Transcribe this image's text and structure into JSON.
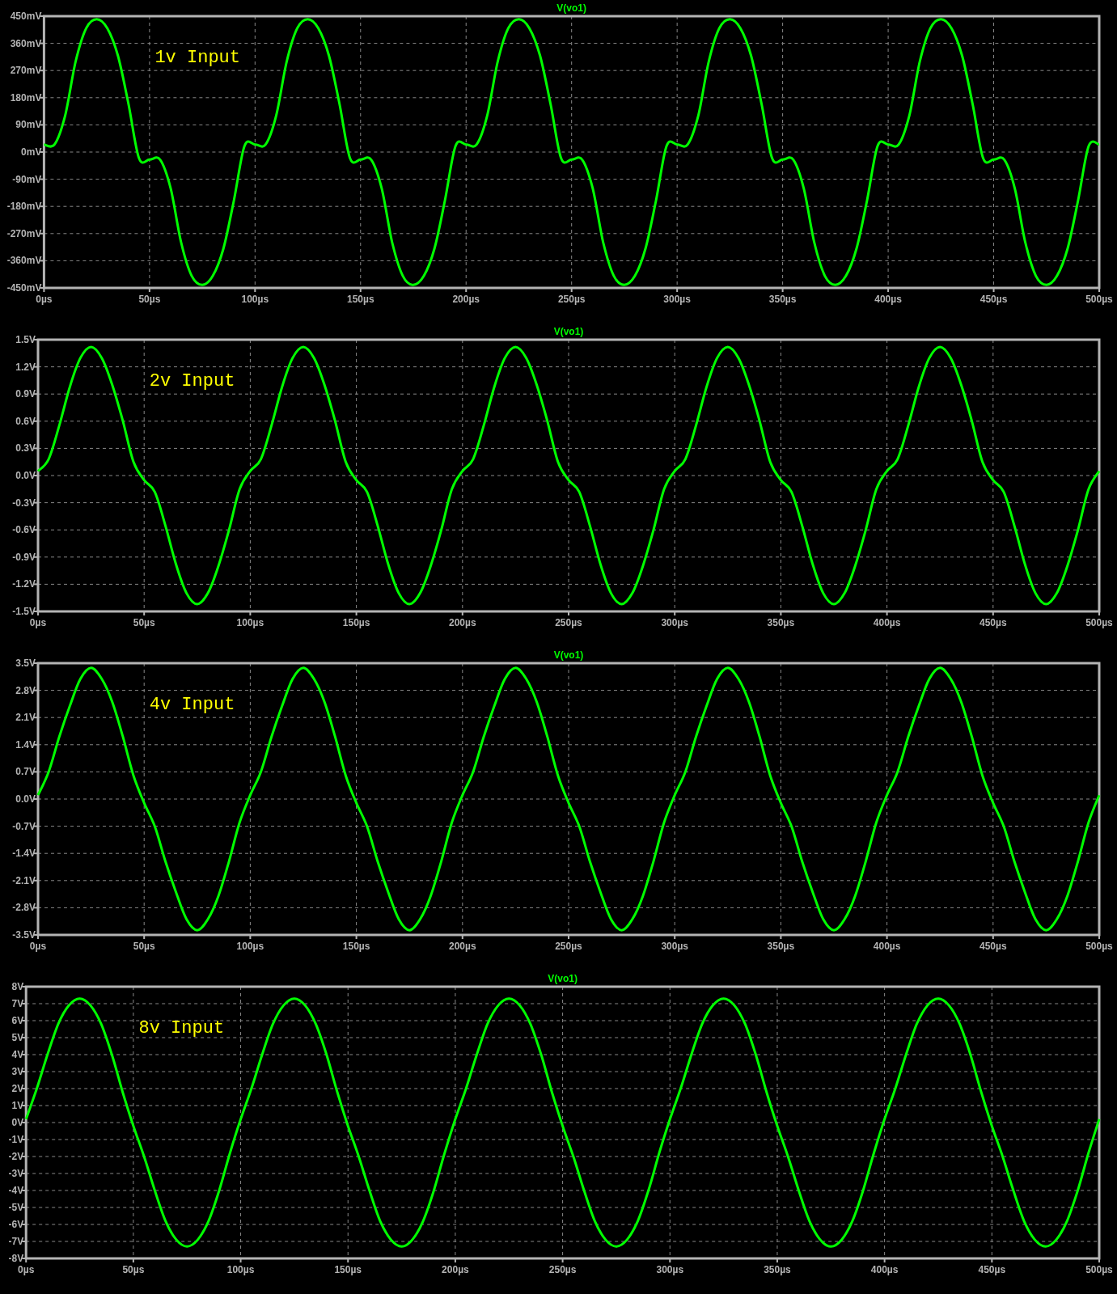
{
  "plots": [
    {
      "chart_data": {
        "type": "line",
        "x": [
          0,
          5,
          10,
          15,
          20,
          25,
          30,
          35,
          40,
          45,
          50,
          55,
          60,
          65,
          70,
          75,
          80,
          85,
          90,
          95,
          100,
          105,
          110,
          115,
          120,
          125,
          130,
          135,
          140,
          145,
          150,
          155,
          160,
          165,
          170,
          175,
          180,
          185,
          190,
          195,
          200,
          205,
          210,
          215,
          220,
          225,
          230,
          235,
          240,
          245,
          250,
          255,
          260,
          265,
          270,
          275,
          280,
          285,
          290,
          295,
          300,
          305,
          310,
          315,
          320,
          325,
          330,
          335,
          340,
          345,
          350,
          355,
          360,
          365,
          370,
          375,
          380,
          385,
          390,
          395,
          400,
          405,
          410,
          415,
          420,
          425,
          430,
          435,
          440,
          445,
          450,
          455,
          460,
          465,
          470,
          475,
          480,
          485,
          490,
          495,
          500
        ],
        "series": [
          {
            "name": "V(vo1)",
            "color": "#00ff00",
            "values": [
              25,
              25,
              120,
              300,
              410,
              440,
              410,
              320,
              160,
              -20,
              -25,
              -25,
              -120,
              -300,
              -410,
              -440,
              -410,
              -320,
              -160,
              20,
              25,
              25,
              120,
              300,
              410,
              440,
              410,
              320,
              160,
              -20,
              -25,
              -25,
              -120,
              -300,
              -410,
              -440,
              -410,
              -320,
              -160,
              20,
              25,
              25,
              120,
              300,
              410,
              440,
              410,
              320,
              160,
              -20,
              -25,
              -25,
              -120,
              -300,
              -410,
              -440,
              -410,
              -320,
              -160,
              20,
              25,
              25,
              120,
              300,
              410,
              440,
              410,
              320,
              160,
              -20,
              -25,
              -25,
              -120,
              -300,
              -410,
              -440,
              -410,
              -320,
              -160,
              20,
              25,
              25,
              120,
              300,
              410,
              440,
              410,
              320,
              160,
              -20,
              -25,
              -25,
              -120,
              -300,
              -410,
              -440,
              -410,
              -320,
              -160,
              20,
              25
            ]
          }
        ],
        "xlim": [
          0,
          500
        ],
        "ylim": [
          -450,
          450
        ],
        "grid": true,
        "xticks": [
          {
            "value": 0,
            "label": "0µs"
          },
          {
            "value": 50,
            "label": "50µs"
          },
          {
            "value": 100,
            "label": "100µs"
          },
          {
            "value": 150,
            "label": "150µs"
          },
          {
            "value": 200,
            "label": "200µs"
          },
          {
            "value": 250,
            "label": "250µs"
          },
          {
            "value": 300,
            "label": "300µs"
          },
          {
            "value": 350,
            "label": "350µs"
          },
          {
            "value": 400,
            "label": "400µs"
          },
          {
            "value": 450,
            "label": "450µs"
          },
          {
            "value": 500,
            "label": "500µs"
          }
        ],
        "yticks": [
          {
            "value": 450,
            "label": "450mV"
          },
          {
            "value": 360,
            "label": "360mV"
          },
          {
            "value": 270,
            "label": "270mV"
          },
          {
            "value": 180,
            "label": "180mV"
          },
          {
            "value": 90,
            "label": "90mV"
          },
          {
            "value": 0,
            "label": "0mV"
          },
          {
            "value": -90,
            "label": "-90mV"
          },
          {
            "value": -180,
            "label": "-180mV"
          },
          {
            "value": -270,
            "label": "-270mV"
          },
          {
            "value": -360,
            "label": "-360mV"
          },
          {
            "value": -450,
            "label": "-450mV"
          }
        ],
        "annotations": [
          "1v Input"
        ]
      }
    },
    {
      "chart_data": {
        "type": "line",
        "x": [
          0,
          5,
          10,
          15,
          20,
          25,
          30,
          35,
          40,
          45,
          50,
          55,
          60,
          65,
          70,
          75,
          80,
          85,
          90,
          95,
          100,
          105,
          110,
          115,
          120,
          125,
          130,
          135,
          140,
          145,
          150,
          155,
          160,
          165,
          170,
          175,
          180,
          185,
          190,
          195,
          200,
          205,
          210,
          215,
          220,
          225,
          230,
          235,
          240,
          245,
          250,
          255,
          260,
          265,
          270,
          275,
          280,
          285,
          290,
          295,
          300,
          305,
          310,
          315,
          320,
          325,
          330,
          335,
          340,
          345,
          350,
          355,
          360,
          365,
          370,
          375,
          380,
          385,
          390,
          395,
          400,
          405,
          410,
          415,
          420,
          425,
          430,
          435,
          440,
          445,
          450,
          455,
          460,
          465,
          470,
          475,
          480,
          485,
          490,
          495,
          500
        ],
        "series": [
          {
            "name": "V(vo1)",
            "color": "#00ff00",
            "values": [
              0.05,
              0.18,
              0.55,
              0.98,
              1.3,
              1.42,
              1.3,
              1.0,
              0.6,
              0.15,
              -0.05,
              -0.18,
              -0.55,
              -0.98,
              -1.3,
              -1.42,
              -1.3,
              -1.0,
              -0.6,
              -0.15,
              0.05,
              0.18,
              0.55,
              0.98,
              1.3,
              1.42,
              1.3,
              1.0,
              0.6,
              0.15,
              -0.05,
              -0.18,
              -0.55,
              -0.98,
              -1.3,
              -1.42,
              -1.3,
              -1.0,
              -0.6,
              -0.15,
              0.05,
              0.18,
              0.55,
              0.98,
              1.3,
              1.42,
              1.3,
              1.0,
              0.6,
              0.15,
              -0.05,
              -0.18,
              -0.55,
              -0.98,
              -1.3,
              -1.42,
              -1.3,
              -1.0,
              -0.6,
              -0.15,
              0.05,
              0.18,
              0.55,
              0.98,
              1.3,
              1.42,
              1.3,
              1.0,
              0.6,
              0.15,
              -0.05,
              -0.18,
              -0.55,
              -0.98,
              -1.3,
              -1.42,
              -1.3,
              -1.0,
              -0.6,
              -0.15,
              0.05,
              0.18,
              0.55,
              0.98,
              1.3,
              1.42,
              1.3,
              1.0,
              0.6,
              0.15,
              -0.05,
              -0.18,
              -0.55,
              -0.98,
              -1.3,
              -1.42,
              -1.3,
              -1.0,
              -0.6,
              -0.15,
              0.05
            ]
          }
        ],
        "xlim": [
          0,
          500
        ],
        "ylim": [
          -1.5,
          1.5
        ],
        "grid": true,
        "xticks": [
          {
            "value": 0,
            "label": "0µs"
          },
          {
            "value": 50,
            "label": "50µs"
          },
          {
            "value": 100,
            "label": "100µs"
          },
          {
            "value": 150,
            "label": "150µs"
          },
          {
            "value": 200,
            "label": "200µs"
          },
          {
            "value": 250,
            "label": "250µs"
          },
          {
            "value": 300,
            "label": "300µs"
          },
          {
            "value": 350,
            "label": "350µs"
          },
          {
            "value": 400,
            "label": "400µs"
          },
          {
            "value": 450,
            "label": "450µs"
          },
          {
            "value": 500,
            "label": "500µs"
          }
        ],
        "yticks": [
          {
            "value": 1.5,
            "label": "1.5V"
          },
          {
            "value": 1.2,
            "label": "1.2V"
          },
          {
            "value": 0.9,
            "label": "0.9V"
          },
          {
            "value": 0.6,
            "label": "0.6V"
          },
          {
            "value": 0.3,
            "label": "0.3V"
          },
          {
            "value": 0,
            "label": "0.0V"
          },
          {
            "value": -0.3,
            "label": "-0.3V"
          },
          {
            "value": -0.6,
            "label": "-0.6V"
          },
          {
            "value": -0.9,
            "label": "-0.9V"
          },
          {
            "value": -1.2,
            "label": "-1.2V"
          },
          {
            "value": -1.5,
            "label": "-1.5V"
          }
        ],
        "annotations": [
          "2v Input"
        ]
      }
    },
    {
      "chart_data": {
        "type": "line",
        "x": [
          0,
          5,
          10,
          15,
          20,
          25,
          30,
          35,
          40,
          45,
          50,
          55,
          60,
          65,
          70,
          75,
          80,
          85,
          90,
          95,
          100,
          105,
          110,
          115,
          120,
          125,
          130,
          135,
          140,
          145,
          150,
          155,
          160,
          165,
          170,
          175,
          180,
          185,
          190,
          195,
          200,
          205,
          210,
          215,
          220,
          225,
          230,
          235,
          240,
          245,
          250,
          255,
          260,
          265,
          270,
          275,
          280,
          285,
          290,
          295,
          300,
          305,
          310,
          315,
          320,
          325,
          330,
          335,
          340,
          345,
          350,
          355,
          360,
          365,
          370,
          375,
          380,
          385,
          390,
          395,
          400,
          405,
          410,
          415,
          420,
          425,
          430,
          435,
          440,
          445,
          450,
          455,
          460,
          465,
          470,
          475,
          480,
          485,
          490,
          495,
          500
        ],
        "series": [
          {
            "name": "V(vo1)",
            "color": "#00ff00",
            "values": [
              0.1,
              0.7,
              1.6,
              2.4,
              3.1,
              3.38,
              3.1,
              2.5,
              1.6,
              0.6,
              -0.1,
              -0.7,
              -1.6,
              -2.4,
              -3.1,
              -3.38,
              -3.1,
              -2.5,
              -1.6,
              -0.6,
              0.1,
              0.7,
              1.6,
              2.4,
              3.1,
              3.38,
              3.1,
              2.5,
              1.6,
              0.6,
              -0.1,
              -0.7,
              -1.6,
              -2.4,
              -3.1,
              -3.38,
              -3.1,
              -2.5,
              -1.6,
              -0.6,
              0.1,
              0.7,
              1.6,
              2.4,
              3.1,
              3.38,
              3.1,
              2.5,
              1.6,
              0.6,
              -0.1,
              -0.7,
              -1.6,
              -2.4,
              -3.1,
              -3.38,
              -3.1,
              -2.5,
              -1.6,
              -0.6,
              0.1,
              0.7,
              1.6,
              2.4,
              3.1,
              3.38,
              3.1,
              2.5,
              1.6,
              0.6,
              -0.1,
              -0.7,
              -1.6,
              -2.4,
              -3.1,
              -3.38,
              -3.1,
              -2.5,
              -1.6,
              -0.6,
              0.1,
              0.7,
              1.6,
              2.4,
              3.1,
              3.38,
              3.1,
              2.5,
              1.6,
              0.6,
              -0.1,
              -0.7,
              -1.6,
              -2.4,
              -3.1,
              -3.38,
              -3.1,
              -2.5,
              -1.6,
              -0.6,
              0.1
            ]
          }
        ],
        "xlim": [
          0,
          500
        ],
        "ylim": [
          -3.5,
          3.5
        ],
        "grid": true,
        "xticks": [
          {
            "value": 0,
            "label": "0µs"
          },
          {
            "value": 50,
            "label": "50µs"
          },
          {
            "value": 100,
            "label": "100µs"
          },
          {
            "value": 150,
            "label": "150µs"
          },
          {
            "value": 200,
            "label": "200µs"
          },
          {
            "value": 250,
            "label": "250µs"
          },
          {
            "value": 300,
            "label": "300µs"
          },
          {
            "value": 350,
            "label": "350µs"
          },
          {
            "value": 400,
            "label": "400µs"
          },
          {
            "value": 450,
            "label": "450µs"
          },
          {
            "value": 500,
            "label": "500µs"
          }
        ],
        "yticks": [
          {
            "value": 3.5,
            "label": "3.5V"
          },
          {
            "value": 2.8,
            "label": "2.8V"
          },
          {
            "value": 2.1,
            "label": "2.1V"
          },
          {
            "value": 1.4,
            "label": "1.4V"
          },
          {
            "value": 0.7,
            "label": "0.7V"
          },
          {
            "value": 0,
            "label": "0.0V"
          },
          {
            "value": -0.7,
            "label": "-0.7V"
          },
          {
            "value": -1.4,
            "label": "-1.4V"
          },
          {
            "value": -2.1,
            "label": "-2.1V"
          },
          {
            "value": -2.8,
            "label": "-2.8V"
          },
          {
            "value": -3.5,
            "label": "-3.5V"
          }
        ],
        "annotations": [
          "4v Input"
        ]
      }
    },
    {
      "chart_data": {
        "type": "line",
        "x": [
          0,
          5,
          10,
          15,
          20,
          25,
          30,
          35,
          40,
          45,
          50,
          55,
          60,
          65,
          70,
          75,
          80,
          85,
          90,
          95,
          100,
          105,
          110,
          115,
          120,
          125,
          130,
          135,
          140,
          145,
          150,
          155,
          160,
          165,
          170,
          175,
          180,
          185,
          190,
          195,
          200,
          205,
          210,
          215,
          220,
          225,
          230,
          235,
          240,
          245,
          250,
          255,
          260,
          265,
          270,
          275,
          280,
          285,
          290,
          295,
          300,
          305,
          310,
          315,
          320,
          325,
          330,
          335,
          340,
          345,
          350,
          355,
          360,
          365,
          370,
          375,
          380,
          385,
          390,
          395,
          400,
          405,
          410,
          415,
          420,
          425,
          430,
          435,
          440,
          445,
          450,
          455,
          460,
          465,
          470,
          475,
          480,
          485,
          490,
          495,
          500
        ],
        "series": [
          {
            "name": "V(vo1)",
            "color": "#00ff00",
            "values": [
              0.2,
              2.0,
              4.0,
              5.8,
              6.9,
              7.3,
              6.9,
              5.8,
              4.0,
              1.8,
              -0.2,
              -2.0,
              -4.0,
              -5.8,
              -6.9,
              -7.3,
              -6.9,
              -5.8,
              -4.0,
              -1.8,
              0.2,
              2.0,
              4.0,
              5.8,
              6.9,
              7.3,
              6.9,
              5.8,
              4.0,
              1.8,
              -0.2,
              -2.0,
              -4.0,
              -5.8,
              -6.9,
              -7.3,
              -6.9,
              -5.8,
              -4.0,
              -1.8,
              0.2,
              2.0,
              4.0,
              5.8,
              6.9,
              7.3,
              6.9,
              5.8,
              4.0,
              1.8,
              -0.2,
              -2.0,
              -4.0,
              -5.8,
              -6.9,
              -7.3,
              -6.9,
              -5.8,
              -4.0,
              -1.8,
              0.2,
              2.0,
              4.0,
              5.8,
              6.9,
              7.3,
              6.9,
              5.8,
              4.0,
              1.8,
              -0.2,
              -2.0,
              -4.0,
              -5.8,
              -6.9,
              -7.3,
              -6.9,
              -5.8,
              -4.0,
              -1.8,
              0.2,
              2.0,
              4.0,
              5.8,
              6.9,
              7.3,
              6.9,
              5.8,
              4.0,
              1.8,
              -0.2,
              -2.0,
              -4.0,
              -5.8,
              -6.9,
              -7.3,
              -6.9,
              -5.8,
              -4.0,
              -1.8,
              0.2
            ]
          }
        ],
        "xlim": [
          0,
          500
        ],
        "ylim": [
          -8,
          8
        ],
        "grid": true,
        "xticks": [
          {
            "value": 0,
            "label": "0µs"
          },
          {
            "value": 50,
            "label": "50µs"
          },
          {
            "value": 100,
            "label": "100µs"
          },
          {
            "value": 150,
            "label": "150µs"
          },
          {
            "value": 200,
            "label": "200µs"
          },
          {
            "value": 250,
            "label": "250µs"
          },
          {
            "value": 300,
            "label": "300µs"
          },
          {
            "value": 350,
            "label": "350µs"
          },
          {
            "value": 400,
            "label": "400µs"
          },
          {
            "value": 450,
            "label": "450µs"
          },
          {
            "value": 500,
            "label": "500µs"
          }
        ],
        "yticks": [
          {
            "value": 8,
            "label": "8V"
          },
          {
            "value": 7,
            "label": "7V"
          },
          {
            "value": 6,
            "label": "6V"
          },
          {
            "value": 5,
            "label": "5V"
          },
          {
            "value": 4,
            "label": "4V"
          },
          {
            "value": 3,
            "label": "3V"
          },
          {
            "value": 2,
            "label": "2V"
          },
          {
            "value": 1,
            "label": "1V"
          },
          {
            "value": 0,
            "label": "0V"
          },
          {
            "value": -1,
            "label": "-1V"
          },
          {
            "value": -2,
            "label": "-2V"
          },
          {
            "value": -3,
            "label": "-3V"
          },
          {
            "value": -4,
            "label": "-4V"
          },
          {
            "value": -5,
            "label": "-5V"
          },
          {
            "value": -6,
            "label": "-6V"
          },
          {
            "value": -7,
            "label": "-7V"
          },
          {
            "value": -8,
            "label": "-8V"
          }
        ],
        "annotations": [
          "8v Input"
        ]
      }
    }
  ]
}
